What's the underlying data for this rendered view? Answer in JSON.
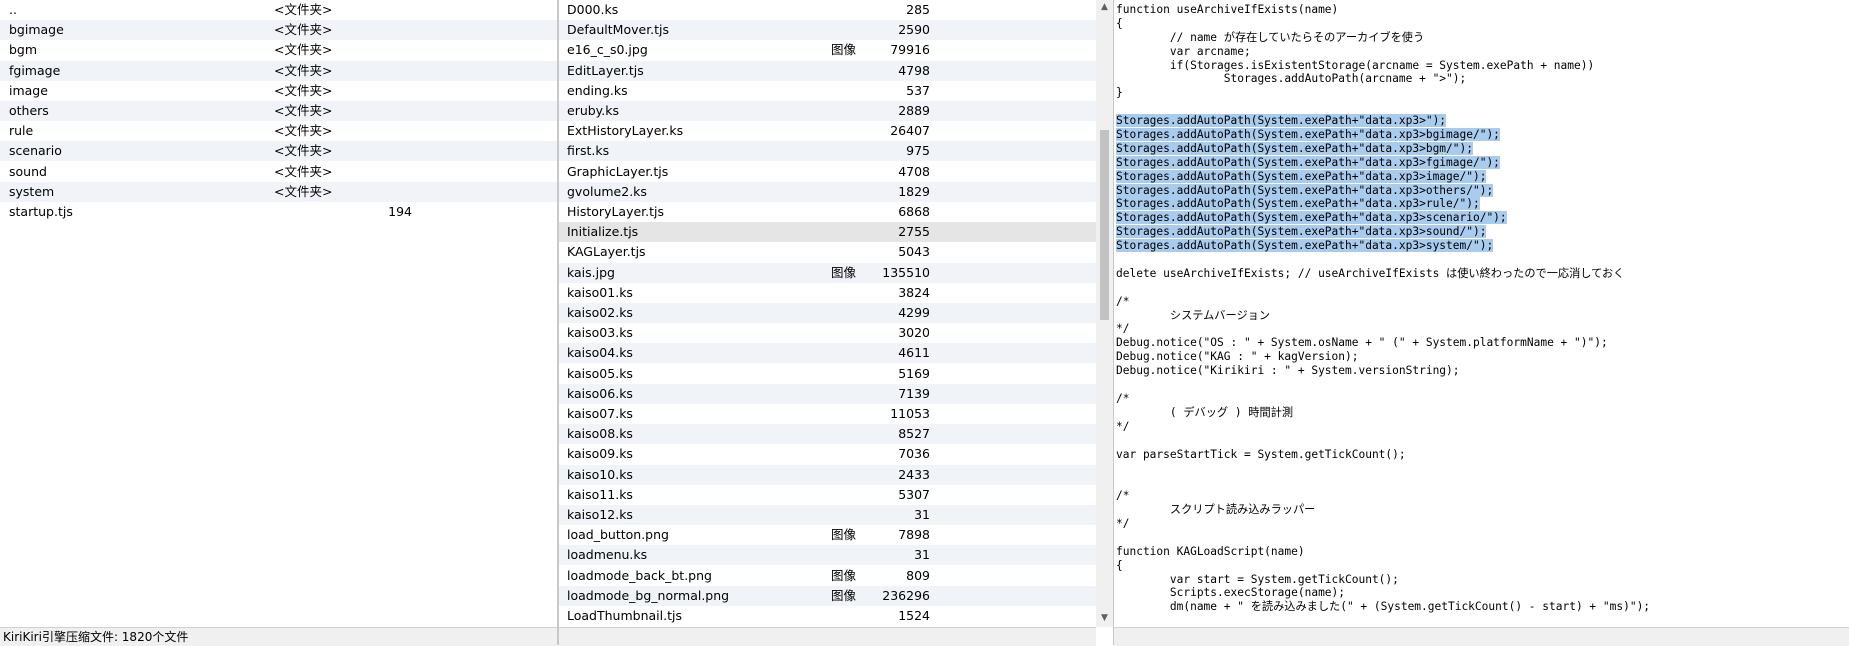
{
  "left_pane": {
    "rows": [
      {
        "name": "..",
        "type": "<文件夹>",
        "size": ""
      },
      {
        "name": "bgimage",
        "type": "<文件夹>",
        "size": ""
      },
      {
        "name": "bgm",
        "type": "<文件夹>",
        "size": ""
      },
      {
        "name": "fgimage",
        "type": "<文件夹>",
        "size": ""
      },
      {
        "name": "image",
        "type": "<文件夹>",
        "size": ""
      },
      {
        "name": "others",
        "type": "<文件夹>",
        "size": ""
      },
      {
        "name": "rule",
        "type": "<文件夹>",
        "size": ""
      },
      {
        "name": "scenario",
        "type": "<文件夹>",
        "size": ""
      },
      {
        "name": "sound",
        "type": "<文件夹>",
        "size": ""
      },
      {
        "name": "system",
        "type": "<文件夹>",
        "size": ""
      },
      {
        "name": "startup.tjs",
        "type": "",
        "size": "194"
      }
    ]
  },
  "middle_pane": {
    "selected_index": 11,
    "rows": [
      {
        "name": "D000.ks",
        "type": "",
        "size": "285"
      },
      {
        "name": "DefaultMover.tjs",
        "type": "",
        "size": "2590"
      },
      {
        "name": "e16_c_s0.jpg",
        "type": "图像",
        "size": "79916"
      },
      {
        "name": "EditLayer.tjs",
        "type": "",
        "size": "4798"
      },
      {
        "name": "ending.ks",
        "type": "",
        "size": "537"
      },
      {
        "name": "eruby.ks",
        "type": "",
        "size": "2889"
      },
      {
        "name": "ExtHistoryLayer.ks",
        "type": "",
        "size": "26407"
      },
      {
        "name": "first.ks",
        "type": "",
        "size": "975"
      },
      {
        "name": "GraphicLayer.tjs",
        "type": "",
        "size": "4708"
      },
      {
        "name": "gvolume2.ks",
        "type": "",
        "size": "1829"
      },
      {
        "name": "HistoryLayer.tjs",
        "type": "",
        "size": "6868"
      },
      {
        "name": "Initialize.tjs",
        "type": "",
        "size": "2755"
      },
      {
        "name": "KAGLayer.tjs",
        "type": "",
        "size": "5043"
      },
      {
        "name": "kais.jpg",
        "type": "图像",
        "size": "135510"
      },
      {
        "name": "kaiso01.ks",
        "type": "",
        "size": "3824"
      },
      {
        "name": "kaiso02.ks",
        "type": "",
        "size": "4299"
      },
      {
        "name": "kaiso03.ks",
        "type": "",
        "size": "3020"
      },
      {
        "name": "kaiso04.ks",
        "type": "",
        "size": "4611"
      },
      {
        "name": "kaiso05.ks",
        "type": "",
        "size": "5169"
      },
      {
        "name": "kaiso06.ks",
        "type": "",
        "size": "7139"
      },
      {
        "name": "kaiso07.ks",
        "type": "",
        "size": "11053"
      },
      {
        "name": "kaiso08.ks",
        "type": "",
        "size": "8527"
      },
      {
        "name": "kaiso09.ks",
        "type": "",
        "size": "7036"
      },
      {
        "name": "kaiso10.ks",
        "type": "",
        "size": "2433"
      },
      {
        "name": "kaiso11.ks",
        "type": "",
        "size": "5307"
      },
      {
        "name": "kaiso12.ks",
        "type": "",
        "size": "31"
      },
      {
        "name": "load_button.png",
        "type": "图像",
        "size": "7898"
      },
      {
        "name": "loadmenu.ks",
        "type": "",
        "size": "31"
      },
      {
        "name": "loadmode_back_bt.png",
        "type": "图像",
        "size": "809"
      },
      {
        "name": "loadmode_bg_normal.png",
        "type": "图像",
        "size": "236296"
      },
      {
        "name": "LoadThumbnail.tjs",
        "type": "",
        "size": "1524"
      }
    ]
  },
  "code_pane": {
    "lines": [
      {
        "text": "function useArchiveIfExists(name)",
        "hl": false
      },
      {
        "text": "{",
        "hl": false
      },
      {
        "text": "        // name が存在していたらそのアーカイブを使う",
        "hl": false
      },
      {
        "text": "        var arcname;",
        "hl": false
      },
      {
        "text": "        if(Storages.isExistentStorage(arcname = System.exePath + name))",
        "hl": false
      },
      {
        "text": "                Storages.addAutoPath(arcname + \">\");",
        "hl": false
      },
      {
        "text": "}",
        "hl": false
      },
      {
        "text": "",
        "hl": false
      },
      {
        "text": "Storages.addAutoPath(System.exePath+\"data.xp3>\");",
        "hl": true
      },
      {
        "text": "Storages.addAutoPath(System.exePath+\"data.xp3>bgimage/\");",
        "hl": true
      },
      {
        "text": "Storages.addAutoPath(System.exePath+\"data.xp3>bgm/\");",
        "hl": true
      },
      {
        "text": "Storages.addAutoPath(System.exePath+\"data.xp3>fgimage/\");",
        "hl": true
      },
      {
        "text": "Storages.addAutoPath(System.exePath+\"data.xp3>image/\");",
        "hl": true
      },
      {
        "text": "Storages.addAutoPath(System.exePath+\"data.xp3>others/\");",
        "hl": true
      },
      {
        "text": "Storages.addAutoPath(System.exePath+\"data.xp3>rule/\");",
        "hl": true
      },
      {
        "text": "Storages.addAutoPath(System.exePath+\"data.xp3>scenario/\");",
        "hl": true
      },
      {
        "text": "Storages.addAutoPath(System.exePath+\"data.xp3>sound/\");",
        "hl": true
      },
      {
        "text": "Storages.addAutoPath(System.exePath+\"data.xp3>system/\");",
        "hl": true
      },
      {
        "text": "",
        "hl": false
      },
      {
        "text": "delete useArchiveIfExists; // useArchiveIfExists は使い終わったので一応消しておく",
        "hl": false
      },
      {
        "text": "",
        "hl": false
      },
      {
        "text": "/*",
        "hl": false
      },
      {
        "text": "        システムバージョン",
        "hl": false
      },
      {
        "text": "*/",
        "hl": false
      },
      {
        "text": "Debug.notice(\"OS : \" + System.osName + \" (\" + System.platformName + \")\");",
        "hl": false
      },
      {
        "text": "Debug.notice(\"KAG : \" + kagVersion);",
        "hl": false
      },
      {
        "text": "Debug.notice(\"Kirikiri : \" + System.versionString);",
        "hl": false
      },
      {
        "text": "",
        "hl": false
      },
      {
        "text": "/*",
        "hl": false
      },
      {
        "text": "        ( デバッグ ) 時間計測",
        "hl": false
      },
      {
        "text": "*/",
        "hl": false
      },
      {
        "text": "",
        "hl": false
      },
      {
        "text": "var parseStartTick = System.getTickCount();",
        "hl": false
      },
      {
        "text": "",
        "hl": false
      },
      {
        "text": "",
        "hl": false
      },
      {
        "text": "/*",
        "hl": false
      },
      {
        "text": "        スクリプト読み込みラッパー",
        "hl": false
      },
      {
        "text": "*/",
        "hl": false
      },
      {
        "text": "",
        "hl": false
      },
      {
        "text": "function KAGLoadScript(name)",
        "hl": false
      },
      {
        "text": "{",
        "hl": false
      },
      {
        "text": "        var start = System.getTickCount();",
        "hl": false
      },
      {
        "text": "        Scripts.execStorage(name);",
        "hl": false
      },
      {
        "text": "        dm(name + \" を読み込みました(\" + (System.getTickCount() - start) + \"ms)\");",
        "hl": false
      }
    ]
  },
  "status_bar": {
    "left_text": "KiriKiri引擎压缩文件: 1820个文件",
    "middle_text": "",
    "right_text": ""
  }
}
